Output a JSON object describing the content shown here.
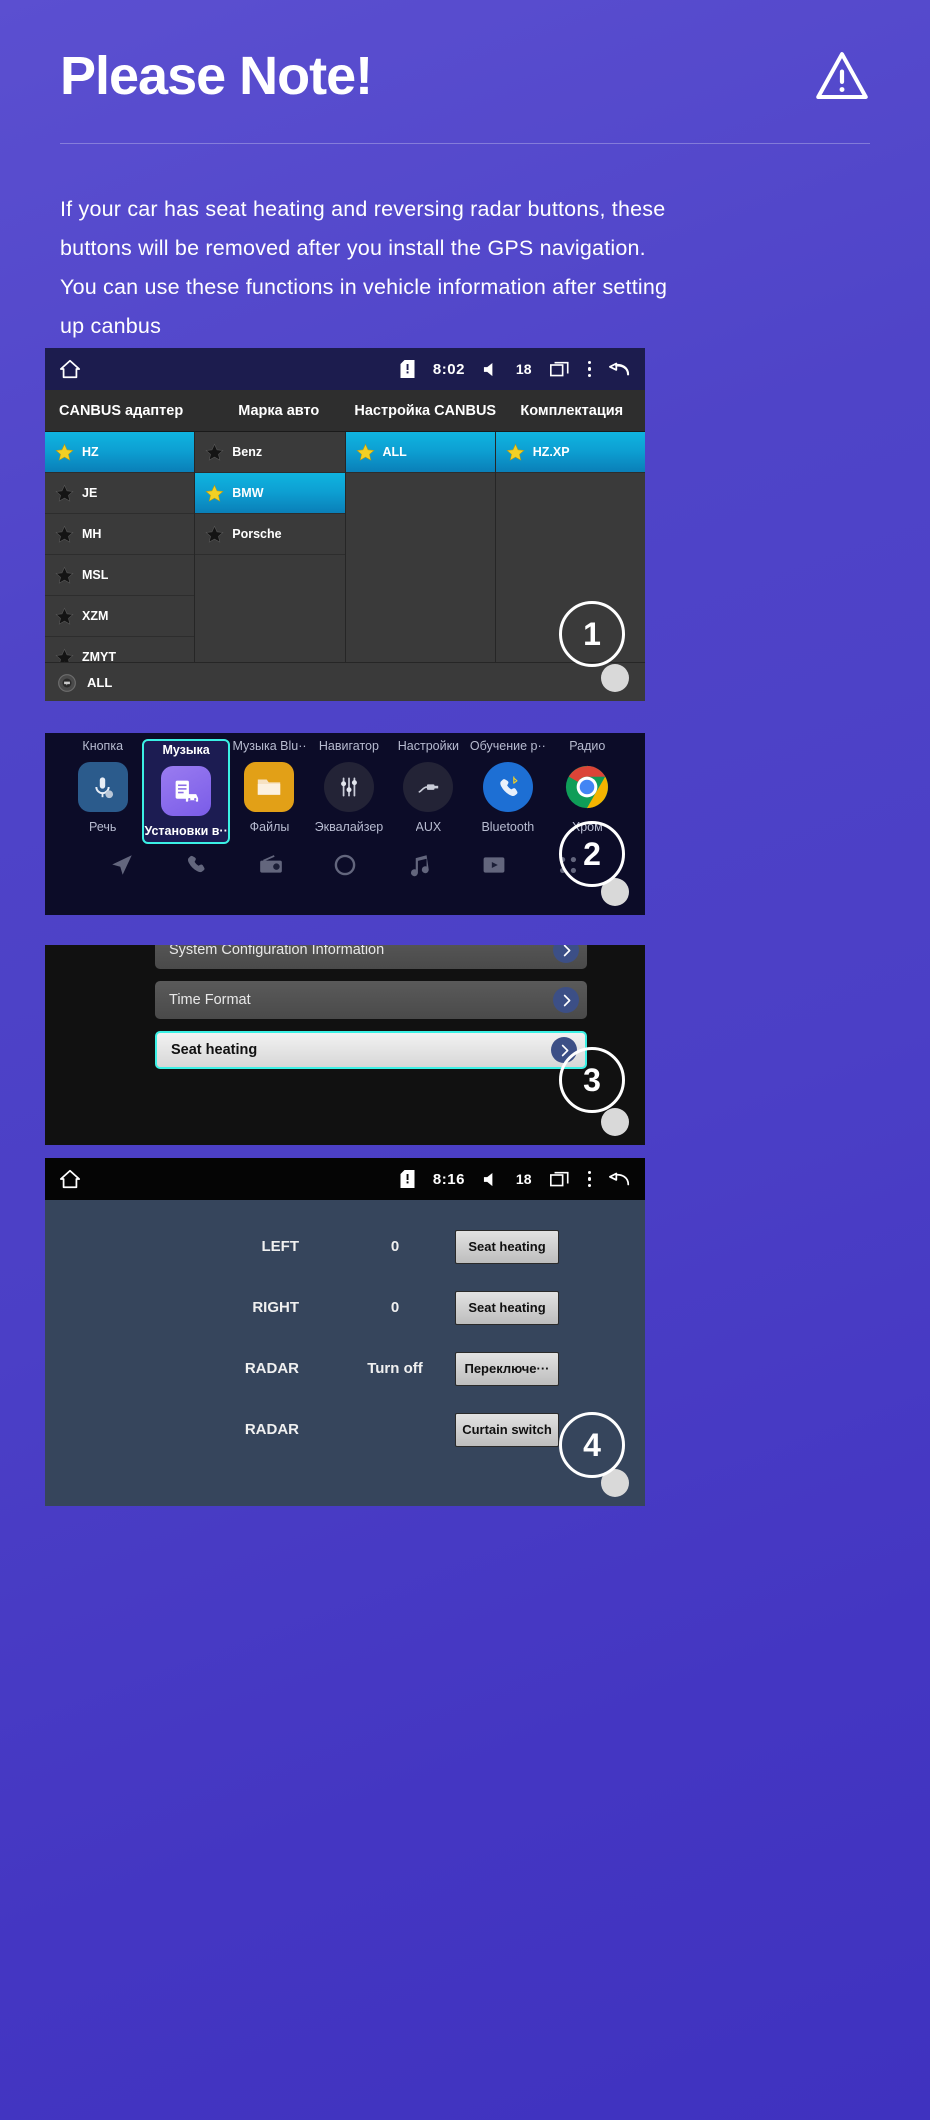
{
  "header": {
    "title": "Please Note!",
    "warning_icon": "warning-triangle-icon",
    "body": "If your car has seat heating and reversing radar buttons, these buttons will be removed after you install the GPS navigation. You can use these functions in vehicle information after setting up canbus"
  },
  "panel1": {
    "marker": "1",
    "statusbar": {
      "home_icon": "home-icon",
      "sd_icon": "sd-card-warning-icon",
      "time": "8:02",
      "speaker_icon": "speaker-icon",
      "volume": "18",
      "recents_icon": "recents-icon",
      "menu_icon": "overflow-menu-icon",
      "back_icon": "back-icon"
    },
    "tabs": [
      {
        "label": "CANBUS адаптер"
      },
      {
        "label": "Марка авто"
      },
      {
        "label": "Настройка CANBUS"
      },
      {
        "label": "Комплектация"
      }
    ],
    "columns": [
      {
        "items": [
          {
            "label": "HZ",
            "selected": true
          },
          {
            "label": "JE",
            "selected": false
          },
          {
            "label": "MH",
            "selected": false
          },
          {
            "label": "MSL",
            "selected": false
          },
          {
            "label": "XZM",
            "selected": false
          },
          {
            "label": "ZMYT",
            "selected": false
          }
        ]
      },
      {
        "items": [
          {
            "label": "Benz",
            "selected": false
          },
          {
            "label": "BMW",
            "selected": true
          },
          {
            "label": "Porsche",
            "selected": false
          }
        ]
      },
      {
        "items": [
          {
            "label": "ALL",
            "selected": true
          }
        ]
      },
      {
        "items": [
          {
            "label": "HZ.XP",
            "selected": true
          }
        ]
      }
    ],
    "bottom": {
      "icon": "globe-language-icon",
      "label": "ALL"
    },
    "home_button": "home-pill-button"
  },
  "panel2": {
    "marker": "2",
    "apps": [
      {
        "top_label": "Кнопка",
        "bottom_label": "Речь",
        "icon": "microphone-settings-icon",
        "active": false
      },
      {
        "top_label": "Музыка",
        "bottom_label": "Установки в··",
        "icon": "car-settings-icon",
        "active": true
      },
      {
        "top_label": "Музыка Blu··",
        "bottom_label": "Файлы",
        "icon": "folder-icon",
        "active": false
      },
      {
        "top_label": "Навигатор",
        "bottom_label": "Эквалайзер",
        "icon": "equalizer-icon",
        "active": false
      },
      {
        "top_label": "Настройки",
        "bottom_label": "AUX",
        "icon": "aux-plug-icon",
        "active": false
      },
      {
        "top_label": "Обучение р··",
        "bottom_label": "Bluetooth",
        "icon": "bluetooth-phone-icon",
        "active": false
      },
      {
        "top_label": "Радио",
        "bottom_label": "Хром",
        "icon": "chrome-icon",
        "active": false
      }
    ],
    "dock": [
      {
        "icon": "navigation-arrow-icon"
      },
      {
        "icon": "phone-icon"
      },
      {
        "icon": "radio-icon"
      },
      {
        "icon": "circle-icon"
      },
      {
        "icon": "music-note-icon"
      },
      {
        "icon": "video-play-icon"
      },
      {
        "icon": "apps-icon"
      }
    ],
    "home_button": "home-pill-button"
  },
  "panel3": {
    "marker": "3",
    "rows": [
      {
        "label": "System Configuration Information",
        "active": false
      },
      {
        "label": "Time Format",
        "active": false
      },
      {
        "label": "Seat heating",
        "active": true
      }
    ],
    "chevron_icon": "chevron-right-icon",
    "home_button": "home-pill-button"
  },
  "panel4": {
    "marker": "4",
    "statusbar": {
      "home_icon": "home-icon",
      "sd_icon": "sd-card-warning-icon",
      "time": "8:16",
      "speaker_icon": "speaker-icon",
      "volume": "18",
      "recents_icon": "recents-icon",
      "menu_icon": "overflow-menu-icon",
      "back_icon": "back-icon"
    },
    "rows": [
      {
        "label": "LEFT",
        "value": "0",
        "button": "Seat heating"
      },
      {
        "label": "RIGHT",
        "value": "0",
        "button": "Seat heating"
      },
      {
        "label": "RADAR",
        "value": "Turn off",
        "button": "Переключе···"
      },
      {
        "label": "RADAR",
        "value": "",
        "button": "Curtain switch"
      }
    ],
    "home_button": "home-pill-button"
  },
  "colors": {
    "background_start": "#5b4fd0",
    "background_end": "#3f32bf",
    "accent_cyan": "#3bf0e4",
    "selection_blue": "#0d9fd2",
    "star_yellow": "#f2d024"
  }
}
